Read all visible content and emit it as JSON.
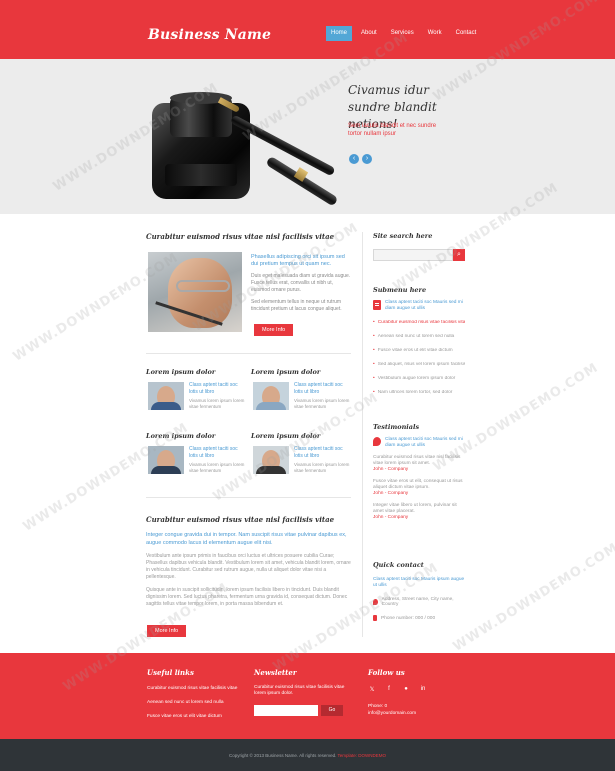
{
  "header": {
    "logo": "Business Name",
    "nav": [
      {
        "label": "Home",
        "active": true
      },
      {
        "label": "About",
        "active": false
      },
      {
        "label": "Services",
        "active": false
      },
      {
        "label": "Work",
        "active": false
      },
      {
        "label": "Contact",
        "active": false
      }
    ]
  },
  "hero": {
    "title": "Civamus idur sundre blandit netions!",
    "subtitle": "Sem iaculis blandit et nec sundre tortor nullam ipsur",
    "prev_icon": "chevron-left-icon",
    "next_icon": "chevron-right-icon",
    "prev_glyph": "‹",
    "next_glyph": "›"
  },
  "main": {
    "feature": {
      "title": "Curabitur euismod risus vitae nisl facilisis vitae",
      "link": "Phasellus adipiscing orci sit ipsum sed dui pretium tempus ut quam nec.",
      "para1": "Duis eget malesuada diam ut gravida augue. Fusce tellus erat, convallis ut nibh ut, euismod ornare purus.",
      "para2": "Sed elementum tellus in neque ut rutrum tincidunt pretium ut lacus congue aliquet.",
      "button": "More Info"
    },
    "minis": [
      {
        "title": "Lorem ipsum dolor",
        "link": "Class aptent taciti soc lotis ut libro",
        "para": "Vivamus lorem ipsum lorem vitae fermentum"
      },
      {
        "title": "Lorem ipsum dolor",
        "link": "Class aptent taciti soc lotis ut libro",
        "para": "Vivamus lorem ipsum lorem vitae fermentum"
      },
      {
        "title": "Lorem ipsum dolor",
        "link": "Class aptent taciti soc lotis ut libro",
        "para": "Vivamus lorem ipsum lorem vitae fermentum"
      },
      {
        "title": "Lorem ipsum dolor",
        "link": "Class aptent taciti soc lotis ut libro",
        "para": "Vivamus lorem ipsum lorem vitae fermentum"
      }
    ],
    "article": {
      "title": "Curabitur euismod risus vitae nisl facilisis vitae",
      "lead": "Integer congue gravida dui in tempor. Nam suscipit risus vitae pulvinar dapibus ex, augue commodo lacus id elementum augue elit nisi.",
      "para1": "Vestibulum ante ipsum primis in faucibus orci luctus et ultrices posuere cubilia Curae; Phasellus dapibus vehicula blandit. Vestibulum lorem sit amet, vehicula blandit lorem, ornare in vehicula tincidunt. Curabitur sed rutrum augue, nulla ut aliquet dolor vitae nisi a pellentesque.",
      "para2": "Quisque ante in suscipit sollicitudin, lorem ipsum facilisis libero in tincidunt. Duis blandit dignissim lorem. Sed luctus pharetra, fermentum urna gravida id, consequat dictum. Donec sagittis tellus vitae tempor lorem, in porta massa bibendum et.",
      "button": "More Info"
    }
  },
  "sidebar": {
    "search_title": "Site search here",
    "search_placeholder": "",
    "search_icon": "search-icon",
    "search_glyph": "🔍",
    "submenu_title": "Submenu here",
    "submenu_link": "Class aptent taciti soc Mauris sed mi diam augue ut ullis",
    "submenu": [
      {
        "label": "Curabitur euismod risus vitae facilisis vitae",
        "active": true
      },
      {
        "label": "Aenean sed nunc ut lorem sed nulla",
        "active": false
      },
      {
        "label": "Fusce vitae eros ut elit vitae dictum",
        "active": false
      },
      {
        "label": "Sed aliquet, risus vel lorem ipsum facilisis",
        "active": false
      },
      {
        "label": "Vestibulum augue lorem ipsum dolor",
        "active": false
      },
      {
        "label": "Nam ultrices lorem tortor, sed dolor",
        "active": false
      }
    ],
    "testimonials_title": "Testimonials",
    "testimonial_link": "Class aptent taciti soc Mauris sed mi diam augue ut ullis",
    "testimonials": [
      {
        "text": "Curabitur euismod risus vitae nisl facilisis vitae lorem ipsum sit amet.",
        "author": "John - Company"
      },
      {
        "text": "Fusce vitae eros ut elit, consequat ut risus aliquet dictum vitae ipsum.",
        "author": "John - Company"
      },
      {
        "text": "Integer vitae libero ut lorem, pulvinar sit amet vitae placerat.",
        "author": "John - Company"
      }
    ],
    "contact_title": "Quick contact",
    "contact_link": "Class aptent taciti soc Mauris ipsum augue ut ullis",
    "contact_address": "Address, Street name, City name, Country",
    "contact_phone": "Phone number: 000 / 000"
  },
  "footer": {
    "col1_title": "Useful links",
    "links": [
      "Curabitur euismod risus vitae facilisis vitae",
      "Aenean sed nunc ut lorem sed nulla",
      "Fusce vitae eros ut elit vitae dictum"
    ],
    "col2_title": "Newsletter",
    "newsletter_text": "Curabitur euismod risus vitae facilisis vitae lorem ipsum dolor.",
    "newsletter_placeholder": "",
    "newsletter_button": "Go",
    "col3_title": "Follow us",
    "social": [
      {
        "icon": "twitter-icon",
        "glyph": "𝕏"
      },
      {
        "icon": "facebook-icon",
        "glyph": "f"
      },
      {
        "icon": "flickr-icon",
        "glyph": "●"
      },
      {
        "icon": "linkedin-icon",
        "glyph": "in"
      }
    ],
    "contact_line1": "Phone: 0",
    "contact_line2": "info@yourdomain.com"
  },
  "bottom": {
    "copyright": "Copyright © 2013 Business Name. All rights reserved.",
    "credit": "Template: DOWNDEMO"
  },
  "watermark": "WWW.DOWNDEMO.COM",
  "colors": {
    "accent": "#e8373d",
    "link": "#4a9ad3",
    "dark": "#2f3438"
  }
}
